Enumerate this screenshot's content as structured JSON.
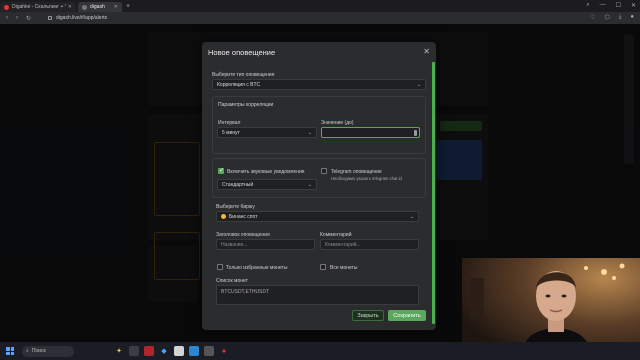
{
  "browser": {
    "tabs": [
      {
        "label": "Digahke - Скальпинг + Y",
        "active": false
      },
      {
        "label": "digash",
        "active": true
      }
    ],
    "url": "digash.live/#/app/alerts"
  },
  "modal": {
    "title": "Новое оповещение",
    "alert_type": {
      "label": "Выберите тип оповещения",
      "value": "Корреляция с BTC"
    },
    "correlation": {
      "heading": "Параметры корреляции",
      "interval_label": "Интервал",
      "interval_value": "5 минут",
      "value_label": "Значение (до)",
      "value_value": ""
    },
    "sound": {
      "label": "Включить звуковые уведомления",
      "checked": true,
      "select_value": "Стандартный"
    },
    "telegram": {
      "label": "Telegram оповещение",
      "checked": false,
      "note": "Необходимо указать telegram chat id"
    },
    "exchange": {
      "label": "Выберите биржу",
      "value": "Бинанс спот"
    },
    "alert_title": {
      "label": "Заголовок оповещения",
      "placeholder": "Название..."
    },
    "comment": {
      "label": "Комментарий",
      "placeholder": "Комментарий..."
    },
    "favorites_only": {
      "label": "Только избранные монеты",
      "checked": false
    },
    "all_coins": {
      "label": "Все монеты",
      "checked": false
    },
    "coin_list": {
      "label": "Список монет",
      "value": "BTCUSDT,ETHUSDT"
    },
    "buttons": {
      "close": "Закрыть",
      "save": "Сохранить"
    }
  },
  "taskbar": {
    "search_label": "Поиск"
  },
  "colors": {
    "accent": "#5aa85c",
    "modal_bg": "#2b2c2e",
    "page_bg": "#0f1011"
  }
}
